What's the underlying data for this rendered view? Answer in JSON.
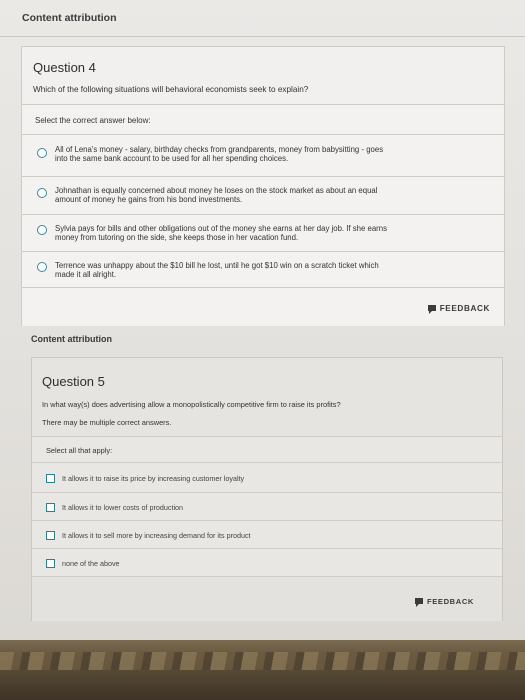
{
  "content_attribution_label": "Content attribution",
  "q4": {
    "title": "Question 4",
    "text": "Which of the following situations will behavioral economists seek to explain?",
    "select_note": "Select the correct answer below:",
    "options": [
      {
        "line1": "All of Lena's money - salary, birthday checks from grandparents, money from babysitting - goes",
        "line2": "into the same bank account to be used for all her spending choices."
      },
      {
        "line1": "Johnathan is equally concerned about money he loses on the stock market as about an equal",
        "line2": "amount of money he gains from his bond investments."
      },
      {
        "line1": "Sylvia pays for bills and other obligations out of the money she earns at her day job. If she earns",
        "line2": "money from tutoring on the side, she keeps those in her vacation fund."
      },
      {
        "line1": "Terrence was unhappy about the $10 bill he lost, until he got $10 win on a scratch ticket which",
        "line2": "made it all alright."
      }
    ],
    "feedback_label": "FEEDBACK"
  },
  "q5": {
    "title": "Question 5",
    "text": "In what way(s) does advertising allow a monopolistically competitive firm to raise its profits?",
    "note": "There may be multiple correct answers.",
    "select_note": "Select all that apply:",
    "options": [
      "It allows it to raise its price by increasing customer loyalty",
      "It allows it to lower costs of production",
      "It allows it to sell more by increasing demand for its product",
      "none of the above"
    ],
    "feedback_label": "FEEDBACK"
  }
}
